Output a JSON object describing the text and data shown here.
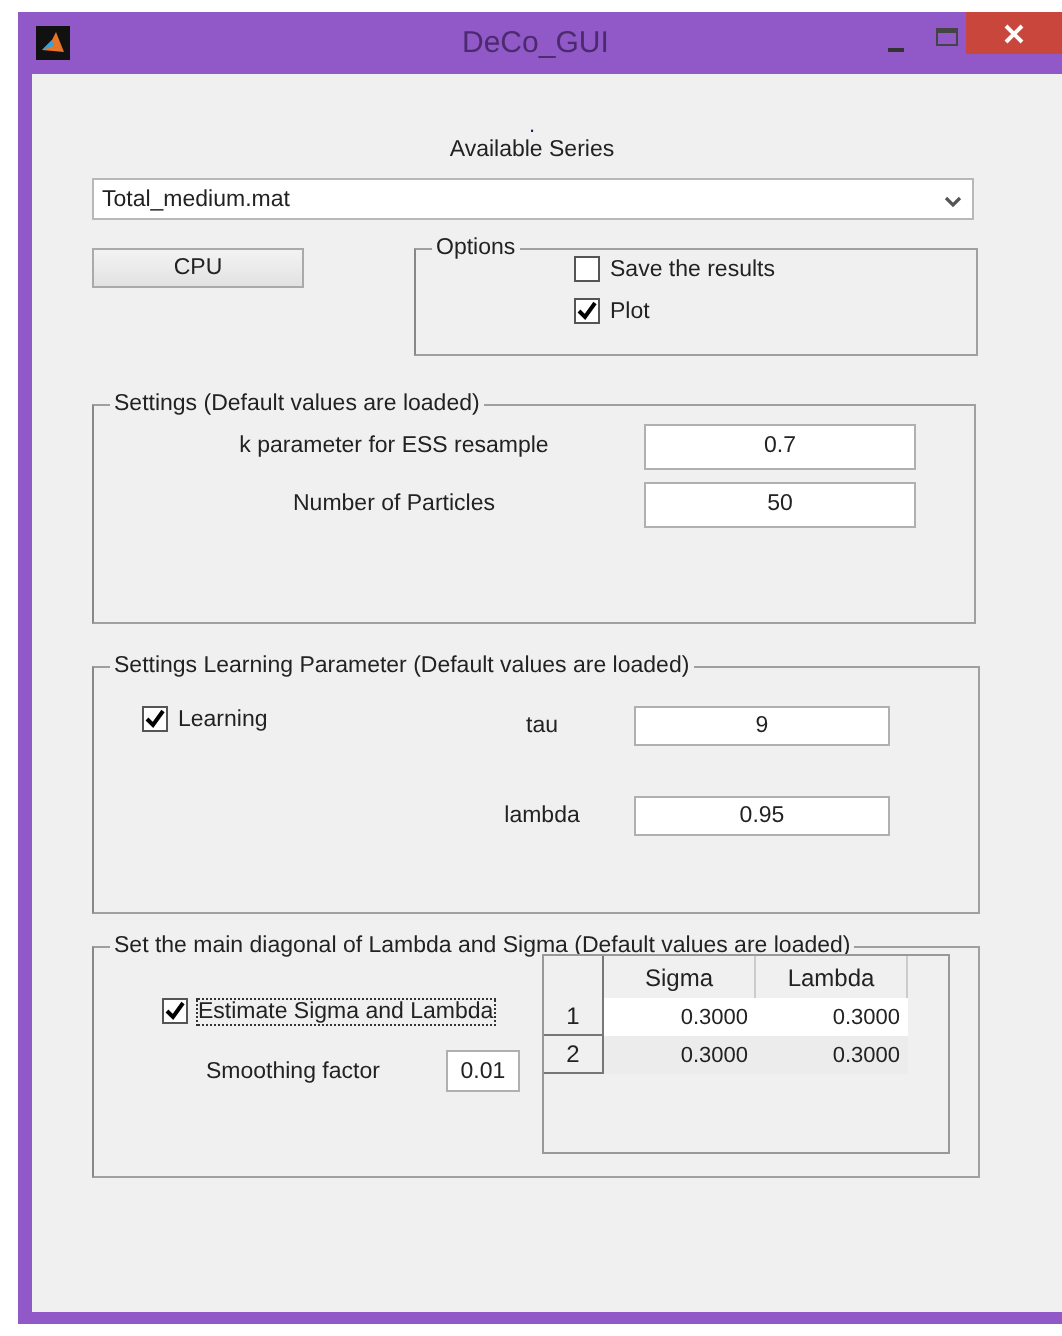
{
  "window": {
    "title": "DeCo_GUI"
  },
  "dot": ".",
  "series": {
    "label": "Available Series",
    "value": "Total_medium.mat"
  },
  "cpu_button": "CPU",
  "options": {
    "title": "Options",
    "items": [
      {
        "label": "Save the results",
        "checked": false
      },
      {
        "label": "Plot",
        "checked": true
      }
    ]
  },
  "settings": {
    "title": "Settings (Default values are loaded)",
    "fields": [
      {
        "label": "k parameter for ESS resample",
        "value": "0.7"
      },
      {
        "label": "Number of Particles",
        "value": "50"
      }
    ]
  },
  "learning": {
    "title": "Settings Learning Parameter (Default values are loaded)",
    "checkbox": {
      "label": "Learning",
      "checked": true
    },
    "fields": [
      {
        "label": "tau",
        "value": "9"
      },
      {
        "label": "lambda",
        "value": "0.95"
      }
    ]
  },
  "diagonal": {
    "title": "Set the main diagonal of Lambda and Sigma (Default values are loaded)",
    "checkbox": {
      "label": "Estimate Sigma and Lambda",
      "checked": true
    },
    "smoothing": {
      "label": "Smoothing factor",
      "value": "0.01"
    },
    "table": {
      "columns": [
        "Sigma",
        "Lambda"
      ],
      "rows": [
        {
          "header": "1",
          "cells": [
            "0.3000",
            "0.3000"
          ]
        },
        {
          "header": "2",
          "cells": [
            "0.3000",
            "0.3000"
          ]
        }
      ]
    }
  }
}
